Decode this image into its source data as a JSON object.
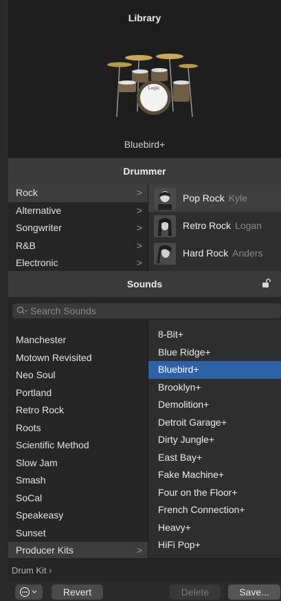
{
  "library": {
    "title": "Library",
    "kit_name": "Bluebird+"
  },
  "drummer": {
    "header": "Drummer",
    "genres": [
      {
        "label": "Rock",
        "selected": true
      },
      {
        "label": "Alternative",
        "selected": false
      },
      {
        "label": "Songwriter",
        "selected": false
      },
      {
        "label": "R&B",
        "selected": false
      },
      {
        "label": "Electronic",
        "selected": false
      }
    ],
    "drummers": [
      {
        "style": "Pop Rock",
        "name": "Kyle",
        "selected": true
      },
      {
        "style": "Retro Rock",
        "name": "Logan",
        "selected": false
      },
      {
        "style": "Hard Rock",
        "name": "Anders",
        "selected": false
      }
    ]
  },
  "sounds": {
    "header": "Sounds",
    "search_placeholder": "Search Sounds",
    "categories": [
      {
        "label": "Manchester",
        "selected": false
      },
      {
        "label": "Motown Revisited",
        "selected": false
      },
      {
        "label": "Neo Soul",
        "selected": false
      },
      {
        "label": "Portland",
        "selected": false
      },
      {
        "label": "Retro Rock",
        "selected": false
      },
      {
        "label": "Roots",
        "selected": false
      },
      {
        "label": "Scientific Method",
        "selected": false
      },
      {
        "label": "Slow Jam",
        "selected": false
      },
      {
        "label": "Smash",
        "selected": false
      },
      {
        "label": "SoCal",
        "selected": false
      },
      {
        "label": "Speakeasy",
        "selected": false
      },
      {
        "label": "Sunset",
        "selected": false
      },
      {
        "label": "Producer Kits",
        "selected": true
      }
    ],
    "patches": [
      {
        "label": "8-Bit+",
        "selected": false
      },
      {
        "label": "Blue Ridge+",
        "selected": false
      },
      {
        "label": "Bluebird+",
        "selected": true
      },
      {
        "label": "Brooklyn+",
        "selected": false
      },
      {
        "label": "Demolition+",
        "selected": false
      },
      {
        "label": "Detroit Garage+",
        "selected": false
      },
      {
        "label": "Dirty Jungle+",
        "selected": false
      },
      {
        "label": "East Bay+",
        "selected": false
      },
      {
        "label": "Fake Machine+",
        "selected": false
      },
      {
        "label": "Four on the Floor+",
        "selected": false
      },
      {
        "label": "French Connection+",
        "selected": false
      },
      {
        "label": "Heavy+",
        "selected": false
      },
      {
        "label": "HiFi Pop+",
        "selected": false
      }
    ]
  },
  "footer": {
    "drum_kit_label": "Drum Kit ›",
    "revert": "Revert",
    "delete": "Delete",
    "save": "Save..."
  },
  "colors": {
    "selection_blue": "#2d62a6",
    "panel_dark": "#1e1e1e",
    "header_gray": "#3a3a3a"
  }
}
